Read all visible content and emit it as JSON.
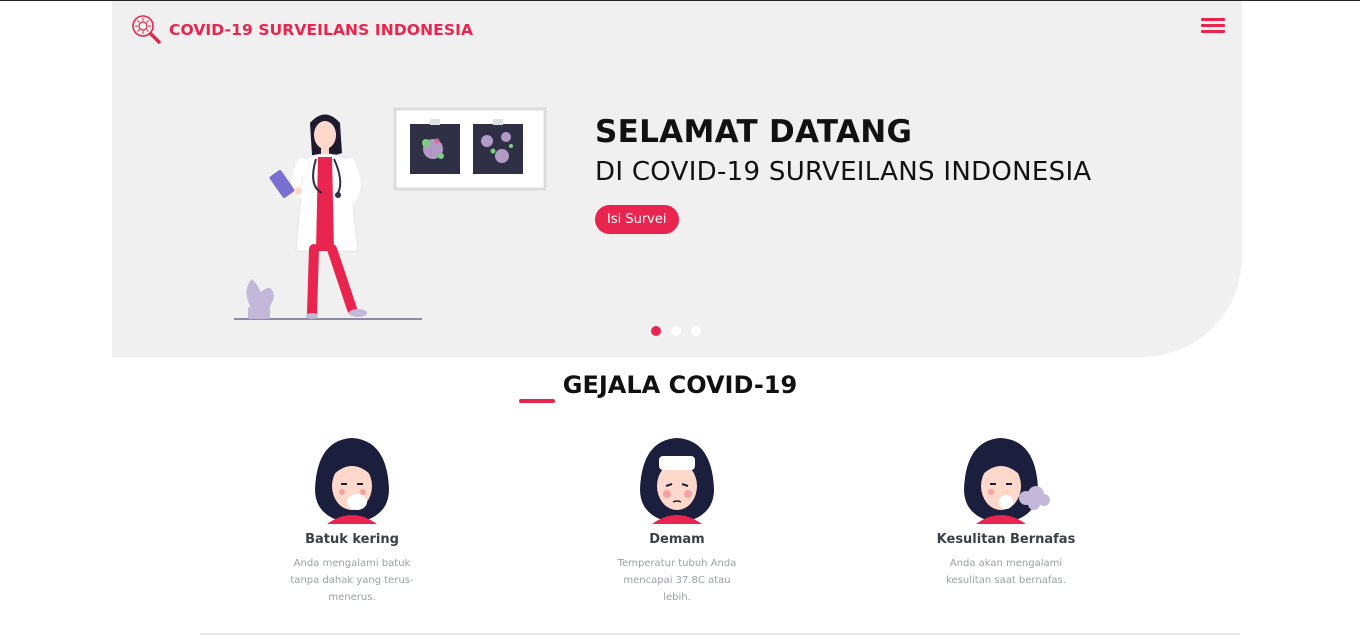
{
  "brand": {
    "name": "COVID-19 SURVEILANS INDONESIA"
  },
  "hero": {
    "title": "SELAMAT DATANG",
    "subtitle": "DI COVID-19 SURVEILANS INDONESIA",
    "cta_label": "Isi Survei",
    "slides_active": 1,
    "slides_total": 3
  },
  "symptoms_section": {
    "title": "GEJALA COVID-19",
    "items": [
      {
        "name": "Batuk kering",
        "description": "Anda mengalami batuk tanpa dahak yang terus-menerus."
      },
      {
        "name": "Demam",
        "description": "Temperatur tubuh Anda mencapai 37.8C atau lebih."
      },
      {
        "name": "Kesulitan Bernafas",
        "description": "Anda akan mengalami kesulitan saat bernafas."
      }
    ]
  },
  "colors": {
    "accent": "#e8244f",
    "hero_bg": "#f0f0f0",
    "text_dark": "#111111"
  }
}
